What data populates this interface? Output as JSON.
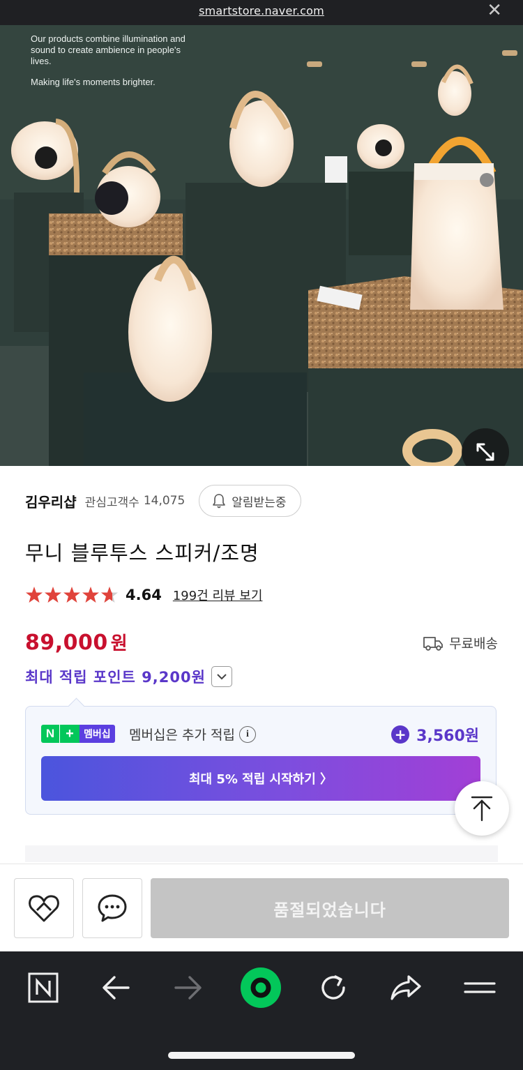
{
  "browser": {
    "url": "smartstore.naver.com",
    "close_glyph": "✕"
  },
  "hero": {
    "caption_line1": "Our products combine illumination and sound to create ambience in people's lives.",
    "caption_line2": "Making life's moments brighter.",
    "expand_icon": "expand-icon"
  },
  "store": {
    "name": "김우리샵",
    "follower_label": "관심고객수",
    "follower_count": "14,075",
    "alarm_label": "알림받는중"
  },
  "product": {
    "title": "무니 블루투스 스피커/조명",
    "rating": "4.64",
    "stars": 4.64,
    "review_link": "199건 리뷰 보기",
    "price": "89,000",
    "currency": "원",
    "shipping": "무료배송",
    "max_points": "최대 적립 포인트 9,200원"
  },
  "membership": {
    "badge_n": "N",
    "badge_plus": "+",
    "badge_label": "멤버십",
    "text": "멤버십은 추가 적립",
    "info_glyph": "i",
    "extra_points": "3,560원",
    "cta": "최대 5% 적립 시작하기 〉"
  },
  "actions": {
    "soldout": "품절되었습니다"
  },
  "colors": {
    "price_red": "#c8102e",
    "points_purple": "#5a37c9",
    "naver_green": "#03c75a"
  }
}
